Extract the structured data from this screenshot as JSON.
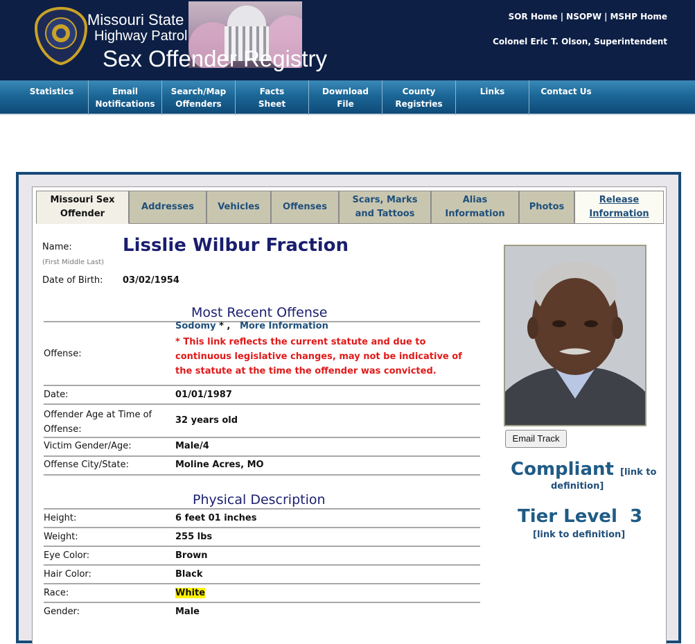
{
  "header": {
    "line1": "Missouri State",
    "line2": "Highway Patrol",
    "title": "Sex Offender Registry",
    "toplinks": [
      "SOR Home",
      "NSOPW",
      "MSHP Home"
    ],
    "superintendent": "Colonel Eric T. Olson, Superintendent"
  },
  "nav": [
    {
      "l1": "Statistics",
      "l2": ""
    },
    {
      "l1": "Email",
      "l2": "Notifications"
    },
    {
      "l1": "Search/Map",
      "l2": "Offenders"
    },
    {
      "l1": "Facts",
      "l2": "Sheet"
    },
    {
      "l1": "Download",
      "l2": "File"
    },
    {
      "l1": "County",
      "l2": "Registries"
    },
    {
      "l1": "Links",
      "l2": ""
    },
    {
      "l1": "Contact Us",
      "l2": ""
    }
  ],
  "tabs": [
    {
      "l1": "Missouri Sex",
      "l2": "Offender"
    },
    {
      "l1": "Addresses",
      "l2": ""
    },
    {
      "l1": "Vehicles",
      "l2": ""
    },
    {
      "l1": "Offenses",
      "l2": ""
    },
    {
      "l1": "Scars, Marks",
      "l2": "and Tattoos"
    },
    {
      "l1": "Alias",
      "l2": "Information"
    },
    {
      "l1": "Photos",
      "l2": ""
    },
    {
      "l1": "Release",
      "l2": "Information"
    }
  ],
  "offender": {
    "name_label": "Name:",
    "name_note": "(First Middle Last)",
    "name": "Lisslie Wilbur Fraction",
    "dob_label": "Date of Birth:",
    "dob": "03/02/1954"
  },
  "offense": {
    "section_title": "Most Recent Offense",
    "offense_label": "Offense:",
    "offense_link": "Sodomy",
    "asterisk": "* ,",
    "more_info": "More Information",
    "warning": "* This link reflects the current statute and due to continuous legislative changes, may not be indicative of the statute at the time the offender was convicted.",
    "date_label": "Date:",
    "date": "01/01/1987",
    "age_label_1": "Offender Age at Time of",
    "age_label_2": "Offense:",
    "age": "32 years old",
    "victim_label": "Victim Gender/Age:",
    "victim": "Male/4",
    "city_label": "Offense City/State:",
    "city": "Moline Acres, MO"
  },
  "physical": {
    "section_title": "Physical Description",
    "height_label": "Height:",
    "height": "6 feet 01 inches",
    "weight_label": "Weight:",
    "weight": "255 lbs",
    "eye_label": "Eye Color:",
    "eye": "Brown",
    "hair_label": "Hair Color:",
    "hair": "Black",
    "race_label": "Race:",
    "race": "White",
    "gender_label": "Gender:",
    "gender": "Male"
  },
  "status": {
    "email_track": "Email Track",
    "compliant": "Compliant",
    "link_open": "[link to",
    "link_close": "definition]",
    "tier": "Tier Level  3",
    "tier_link": "[link to definition]"
  }
}
